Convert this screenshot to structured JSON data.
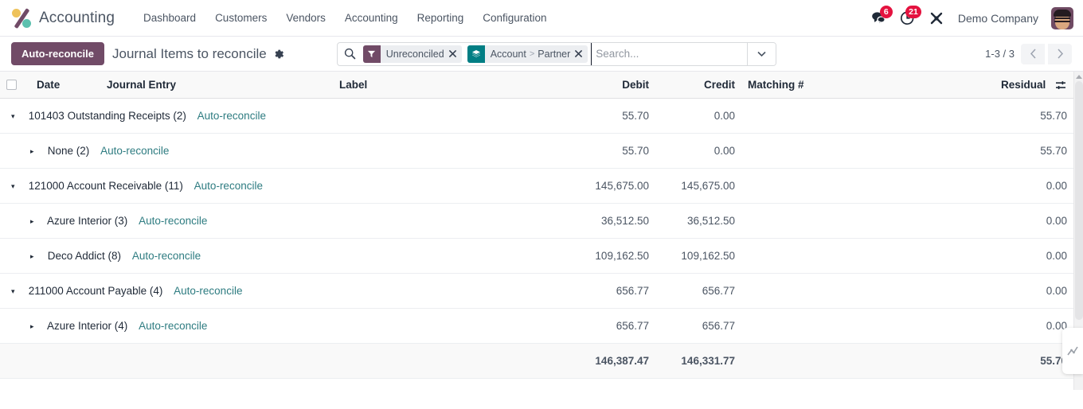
{
  "navbar": {
    "brand": "Accounting",
    "logo_icon": "odoo-accounting-percent-logo",
    "menu": [
      {
        "label": "Dashboard"
      },
      {
        "label": "Customers"
      },
      {
        "label": "Vendors"
      },
      {
        "label": "Accounting"
      },
      {
        "label": "Reporting"
      },
      {
        "label": "Configuration"
      }
    ],
    "systray": {
      "messages": {
        "icon": "messages-icon",
        "count": "6"
      },
      "activities": {
        "icon": "clock-activity-icon",
        "count": "21"
      },
      "apps": {
        "icon": "tools-x-icon"
      },
      "company": "Demo Company",
      "avatar_icon": "user-avatar"
    },
    "badge_color": "#e4123f"
  },
  "control_panel": {
    "auto_reconcile_button": "Auto-reconcile",
    "breadcrumb_title": "Journal Items to reconcile",
    "gear_icon": "gear-icon",
    "search": {
      "search_icon": "search-icon",
      "placeholder": "Search...",
      "value": "",
      "facets": [
        {
          "icon": "filter-icon",
          "color": "#714b67",
          "label": "Unreconciled",
          "remove_icon": "close-icon"
        },
        {
          "icon": "layers-groupby-icon",
          "color": "#017e84",
          "label_parts": [
            "Account",
            ">",
            "Partner"
          ],
          "remove_icon": "close-icon"
        }
      ],
      "toggle_icon": "chevron-down-icon"
    },
    "pager": {
      "value": "1-3 / 3",
      "prev_icon": "chevron-left-icon",
      "next_icon": "chevron-right-icon"
    }
  },
  "table": {
    "select_all_checkbox": "unchecked",
    "columns": [
      {
        "key": "date",
        "label": "Date",
        "align": "left"
      },
      {
        "key": "journal_entry",
        "label": "Journal Entry",
        "align": "left"
      },
      {
        "key": "label",
        "label": "Label",
        "align": "left"
      },
      {
        "key": "debit",
        "label": "Debit",
        "align": "right"
      },
      {
        "key": "credit",
        "label": "Credit",
        "align": "right"
      },
      {
        "key": "matching",
        "label": "Matching #",
        "align": "left"
      },
      {
        "key": "residual",
        "label": "Residual",
        "align": "right"
      }
    ],
    "optional_columns_icon": "column-options-icon",
    "rows": [
      {
        "level": 1,
        "caret": "▾",
        "expanded": true,
        "name": "101403 Outstanding Receipts (2)",
        "action": "Auto-reconcile",
        "debit": "55.70",
        "credit": "0.00",
        "matching": "",
        "residual": "55.70"
      },
      {
        "level": 2,
        "caret": "▸",
        "expanded": false,
        "name": "None (2)",
        "action": "Auto-reconcile",
        "debit": "55.70",
        "credit": "0.00",
        "matching": "",
        "residual": "55.70"
      },
      {
        "level": 1,
        "caret": "▾",
        "expanded": true,
        "name": "121000 Account Receivable (11)",
        "action": "Auto-reconcile",
        "debit": "145,675.00",
        "credit": "145,675.00",
        "matching": "",
        "residual": "0.00"
      },
      {
        "level": 2,
        "caret": "▸",
        "expanded": false,
        "name": "Azure Interior (3)",
        "action": "Auto-reconcile",
        "debit": "36,512.50",
        "credit": "36,512.50",
        "matching": "",
        "residual": "0.00"
      },
      {
        "level": 2,
        "caret": "▸",
        "expanded": false,
        "name": "Deco Addict (8)",
        "action": "Auto-reconcile",
        "debit": "109,162.50",
        "credit": "109,162.50",
        "matching": "",
        "residual": "0.00"
      },
      {
        "level": 1,
        "caret": "▾",
        "expanded": true,
        "name": "211000 Account Payable (4)",
        "action": "Auto-reconcile",
        "debit": "656.77",
        "credit": "656.77",
        "matching": "",
        "residual": "0.00"
      },
      {
        "level": 2,
        "caret": "▸",
        "expanded": false,
        "name": "Azure Interior (4)",
        "action": "Auto-reconcile",
        "debit": "656.77",
        "credit": "656.77",
        "matching": "",
        "residual": "0.00"
      }
    ],
    "footer": {
      "debit": "146,387.47",
      "credit": "146,331.77",
      "matching": "",
      "residual": "55.70"
    }
  },
  "scrollbar": {
    "up_arrow_icon": "scroll-up-arrow-icon",
    "thumb": "vertical-scroll-thumb"
  },
  "float_widget": {
    "icon": "chart-widget-icon"
  },
  "theme": {
    "primary": "#714b67",
    "link": "#2e7c81",
    "groupby_teal": "#017e84"
  }
}
